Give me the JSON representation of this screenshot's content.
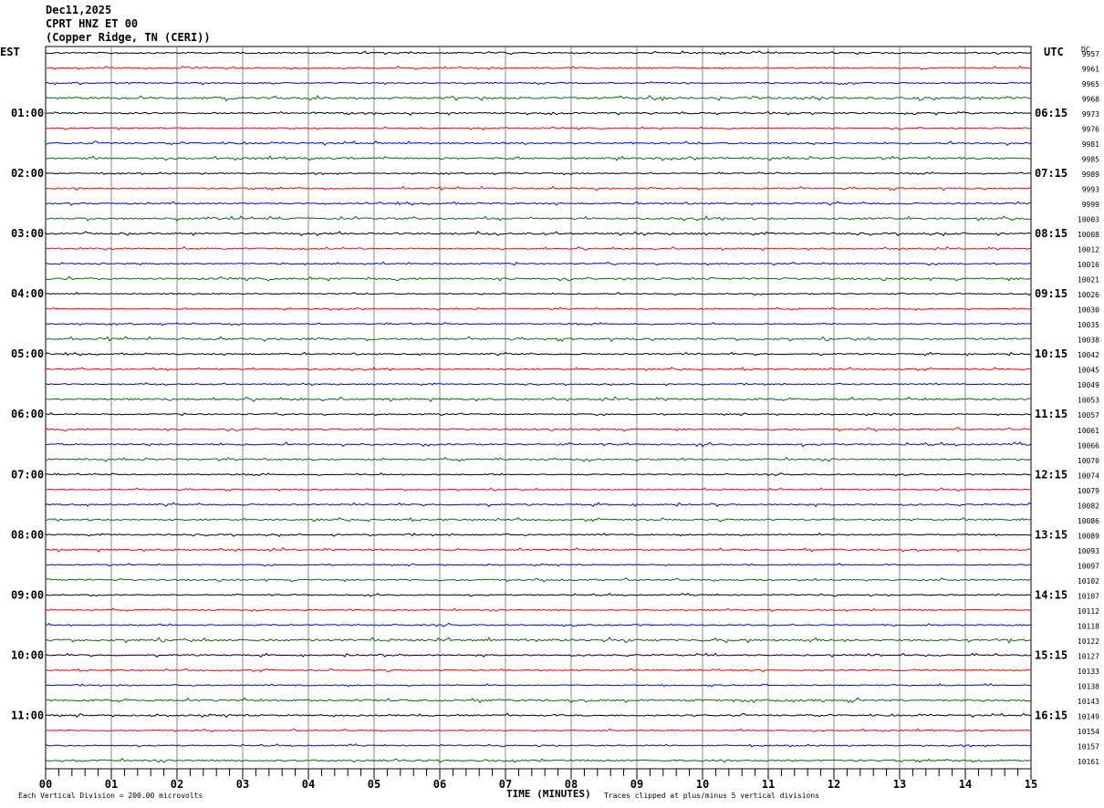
{
  "header": {
    "date": "Dec11,2025",
    "station": "CPRT HNZ ET 00",
    "location": "(Copper Ridge, TN (CERI))"
  },
  "chart_data": {
    "type": "line",
    "subtype": "helicorder",
    "left_timezone": "EST",
    "right_timezone": "UTC",
    "dc_label": "DC",
    "left_hour_labels": [
      "01:00",
      "02:00",
      "03:00",
      "04:00",
      "05:00",
      "06:00",
      "07:00",
      "08:00",
      "09:00",
      "10:00",
      "11:00"
    ],
    "right_hour_labels": [
      "06:15",
      "07:15",
      "08:15",
      "09:15",
      "10:15",
      "11:15",
      "12:15",
      "13:15",
      "14:15",
      "15:15",
      "16:15"
    ],
    "dc_values": [
      "9957",
      "9961",
      "9965",
      "9968",
      "9973",
      "9976",
      "9981",
      "9985",
      "9989",
      "9993",
      "9999",
      "10003",
      "10008",
      "10012",
      "10016",
      "10021",
      "10026",
      "10030",
      "10035",
      "10038",
      "10042",
      "10045",
      "10049",
      "10053",
      "10057",
      "10061",
      "10066",
      "10070",
      "10074",
      "10079",
      "10082",
      "10086",
      "10089",
      "10093",
      "10097",
      "10102",
      "10107",
      "10112",
      "10118",
      "10122",
      "10127",
      "10133",
      "10138",
      "10143",
      "10149",
      "10154",
      "10157",
      "10161"
    ],
    "trace_colors": [
      "#000000",
      "#ff0000",
      "#0000ff",
      "#007000"
    ],
    "x_ticks": [
      "00",
      "01",
      "02",
      "03",
      "04",
      "05",
      "06",
      "07",
      "08",
      "09",
      "10",
      "11",
      "12",
      "13",
      "14",
      "15"
    ],
    "xlim": [
      0,
      15
    ],
    "xlabel": "TIME (MINUTES)",
    "scale_note": "Each Vertical Division =  200.00 microvolts",
    "clip_note": "Traces clipped at plus/minus 5 vertical divisions",
    "grid": true
  }
}
